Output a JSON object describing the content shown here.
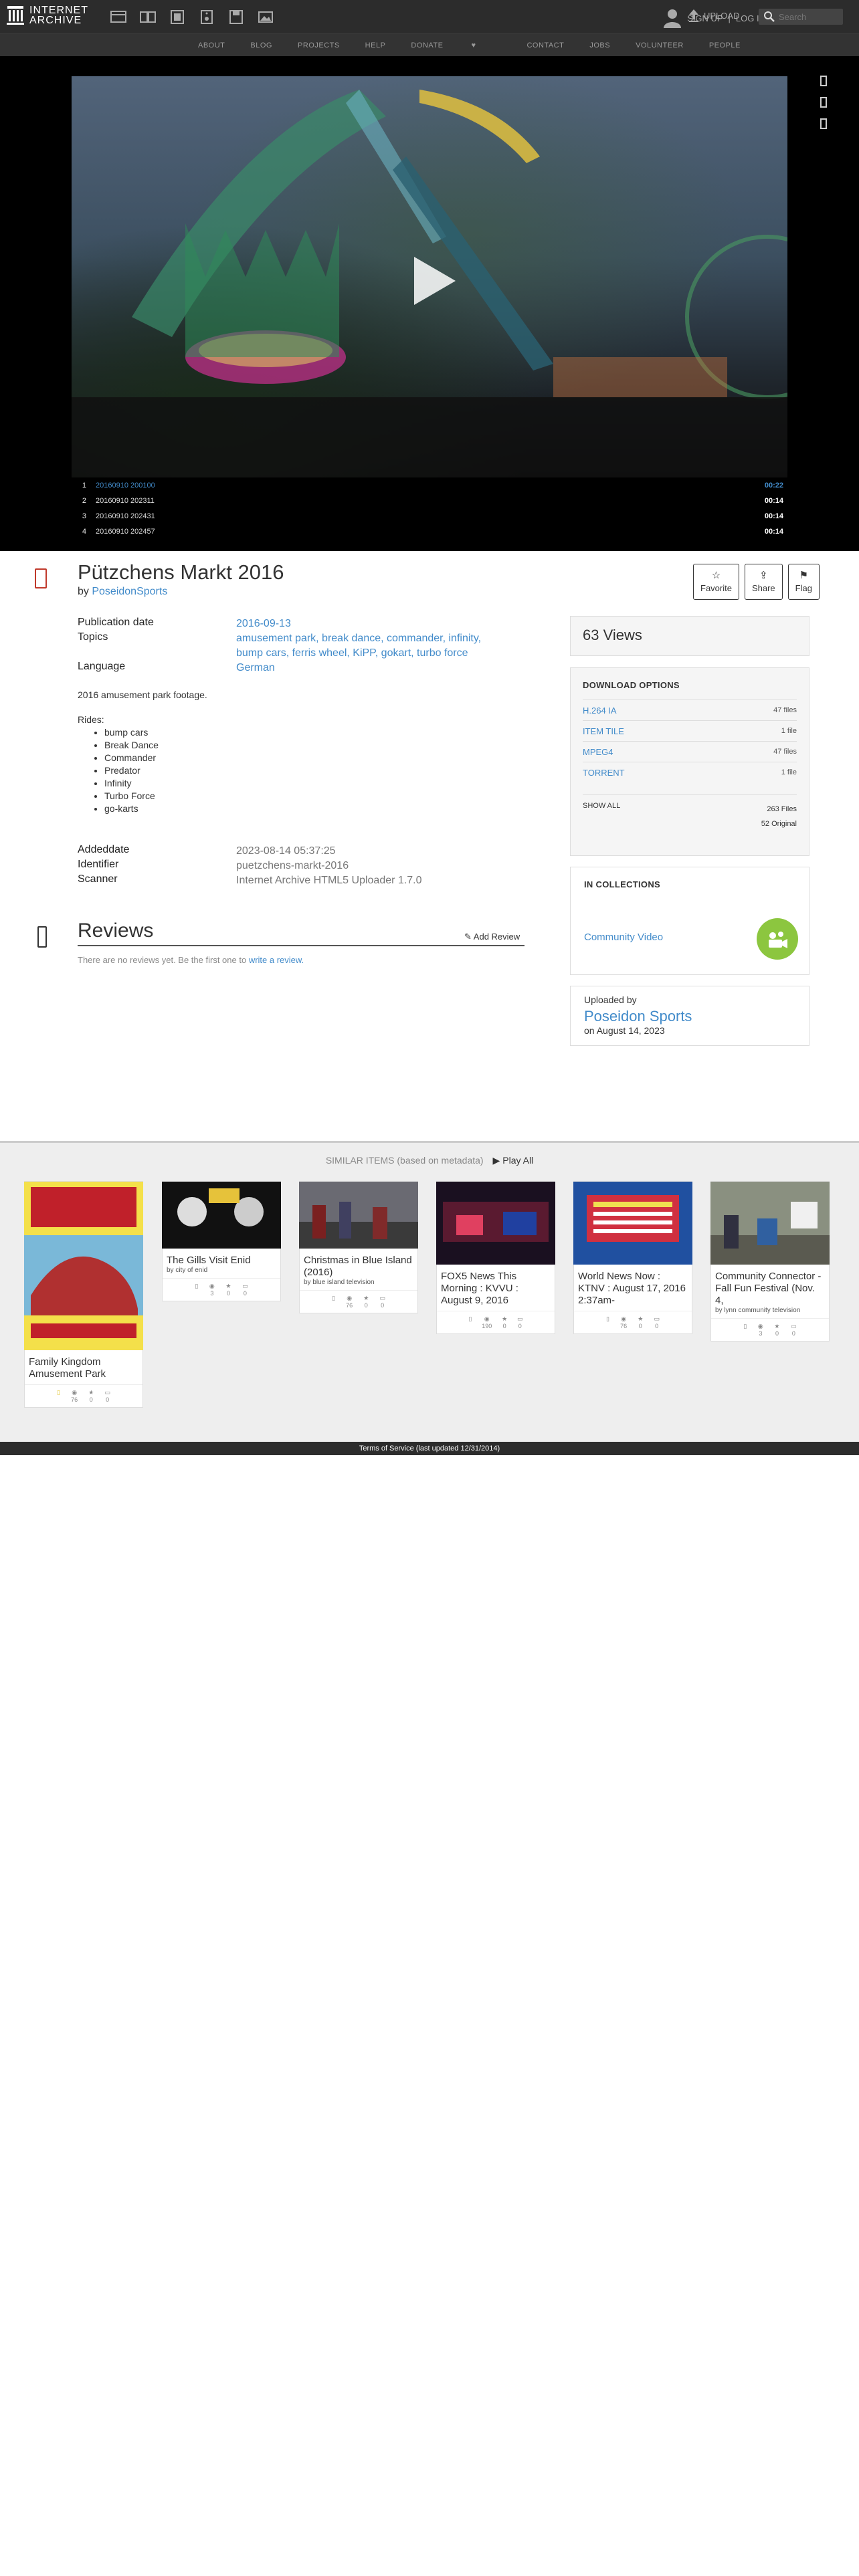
{
  "topnav": {
    "logo_line1": "INTERNET",
    "logo_line2": "ARCHIVE",
    "signup": "SIGN UP",
    "login": "LOG IN",
    "upload": "UPLOAD",
    "search_placeholder": "Search"
  },
  "subnav": [
    "ABOUT",
    "BLOG",
    "PROJECTS",
    "HELP",
    "DONATE",
    "CONTACT",
    "JOBS",
    "VOLUNTEER",
    "PEOPLE"
  ],
  "playlist": [
    {
      "num": "1",
      "name": "20160910 200100",
      "time": "00:22"
    },
    {
      "num": "2",
      "name": "20160910 202311",
      "time": "00:14"
    },
    {
      "num": "3",
      "name": "20160910 202431",
      "time": "00:14"
    },
    {
      "num": "4",
      "name": "20160910 202457",
      "time": "00:14"
    }
  ],
  "item": {
    "title": "Pützchens Markt 2016",
    "by_label": "by",
    "author": "PoseidonSports",
    "favorite": "Favorite",
    "share": "Share",
    "flag": "Flag",
    "pub_date_label": "Publication date",
    "pub_date": "2016-09-13",
    "topics_label": "Topics",
    "topics_line1": "amusement park, break dance, commander, infinity,",
    "topics_line2": "bump cars, ferris wheel, KiPP, gokart, turbo force",
    "language_label": "Language",
    "language": "German",
    "desc_line": "2016 amusement park footage.",
    "rides_label": "Rides:",
    "rides": [
      "bump cars",
      "Break Dance",
      "Commander",
      "Predator",
      "Infinity",
      "Turbo Force",
      "go-karts"
    ],
    "addeddate_label": "Addeddate",
    "addeddate": "2023-08-14 05:37:25",
    "identifier_label": "Identifier",
    "identifier": "puetzchens-markt-2016",
    "scanner_label": "Scanner",
    "scanner": "Internet Archive HTML5 Uploader 1.7.0"
  },
  "reviews": {
    "heading": "Reviews",
    "add": "Add Review",
    "none_text": "There are no reviews yet. Be the first one to",
    "write_link": "write a review."
  },
  "sidebar": {
    "views": "63 Views",
    "downloads_heading": "DOWNLOAD OPTIONS",
    "downloads": [
      {
        "label": "H.264 IA",
        "count": "47 files"
      },
      {
        "label": "ITEM TILE",
        "count": "1 file"
      },
      {
        "label": "MPEG4",
        "count": "47 files"
      },
      {
        "label": "TORRENT",
        "count": "1 file"
      }
    ],
    "show_all": "SHOW ALL",
    "total_files": "263 Files",
    "original": "52 Original",
    "collections_heading": "IN COLLECTIONS",
    "collection": "Community Video",
    "uploaded_by_label": "Uploaded by",
    "uploader": "Poseidon Sports",
    "uploaded_on": "on August 14, 2023"
  },
  "similar": {
    "heading": "SIMILAR ITEMS (based on metadata)",
    "play_all": "Play All",
    "cards": [
      {
        "title": "Family Kingdom Amusement Park",
        "by": "",
        "s1": "",
        "s2": "76",
        "s3": "0",
        "s4": "0"
      },
      {
        "title": "The Gills Visit Enid",
        "by": "by city of enid",
        "s1": "",
        "s2": "3",
        "s3": "0",
        "s4": "0"
      },
      {
        "title": "Christmas in Blue Island (2016)",
        "by": "by blue island television",
        "s1": "",
        "s2": "76",
        "s3": "0",
        "s4": "0"
      },
      {
        "title": "FOX5 News This Morning : KVVU : August 9, 2016",
        "by": "",
        "s1": "",
        "s2": "190",
        "s3": "0",
        "s4": "0"
      },
      {
        "title": "World News Now : KTNV : August 17, 2016 2:37am-",
        "by": "",
        "s1": "",
        "s2": "76",
        "s3": "0",
        "s4": "0"
      },
      {
        "title": "Community Connector - Fall Fun Festival (Nov. 4,",
        "by": "by lynn community television",
        "s1": "",
        "s2": "3",
        "s3": "0",
        "s4": "0"
      }
    ]
  },
  "footer": "Terms of Service (last updated 12/31/2014)"
}
